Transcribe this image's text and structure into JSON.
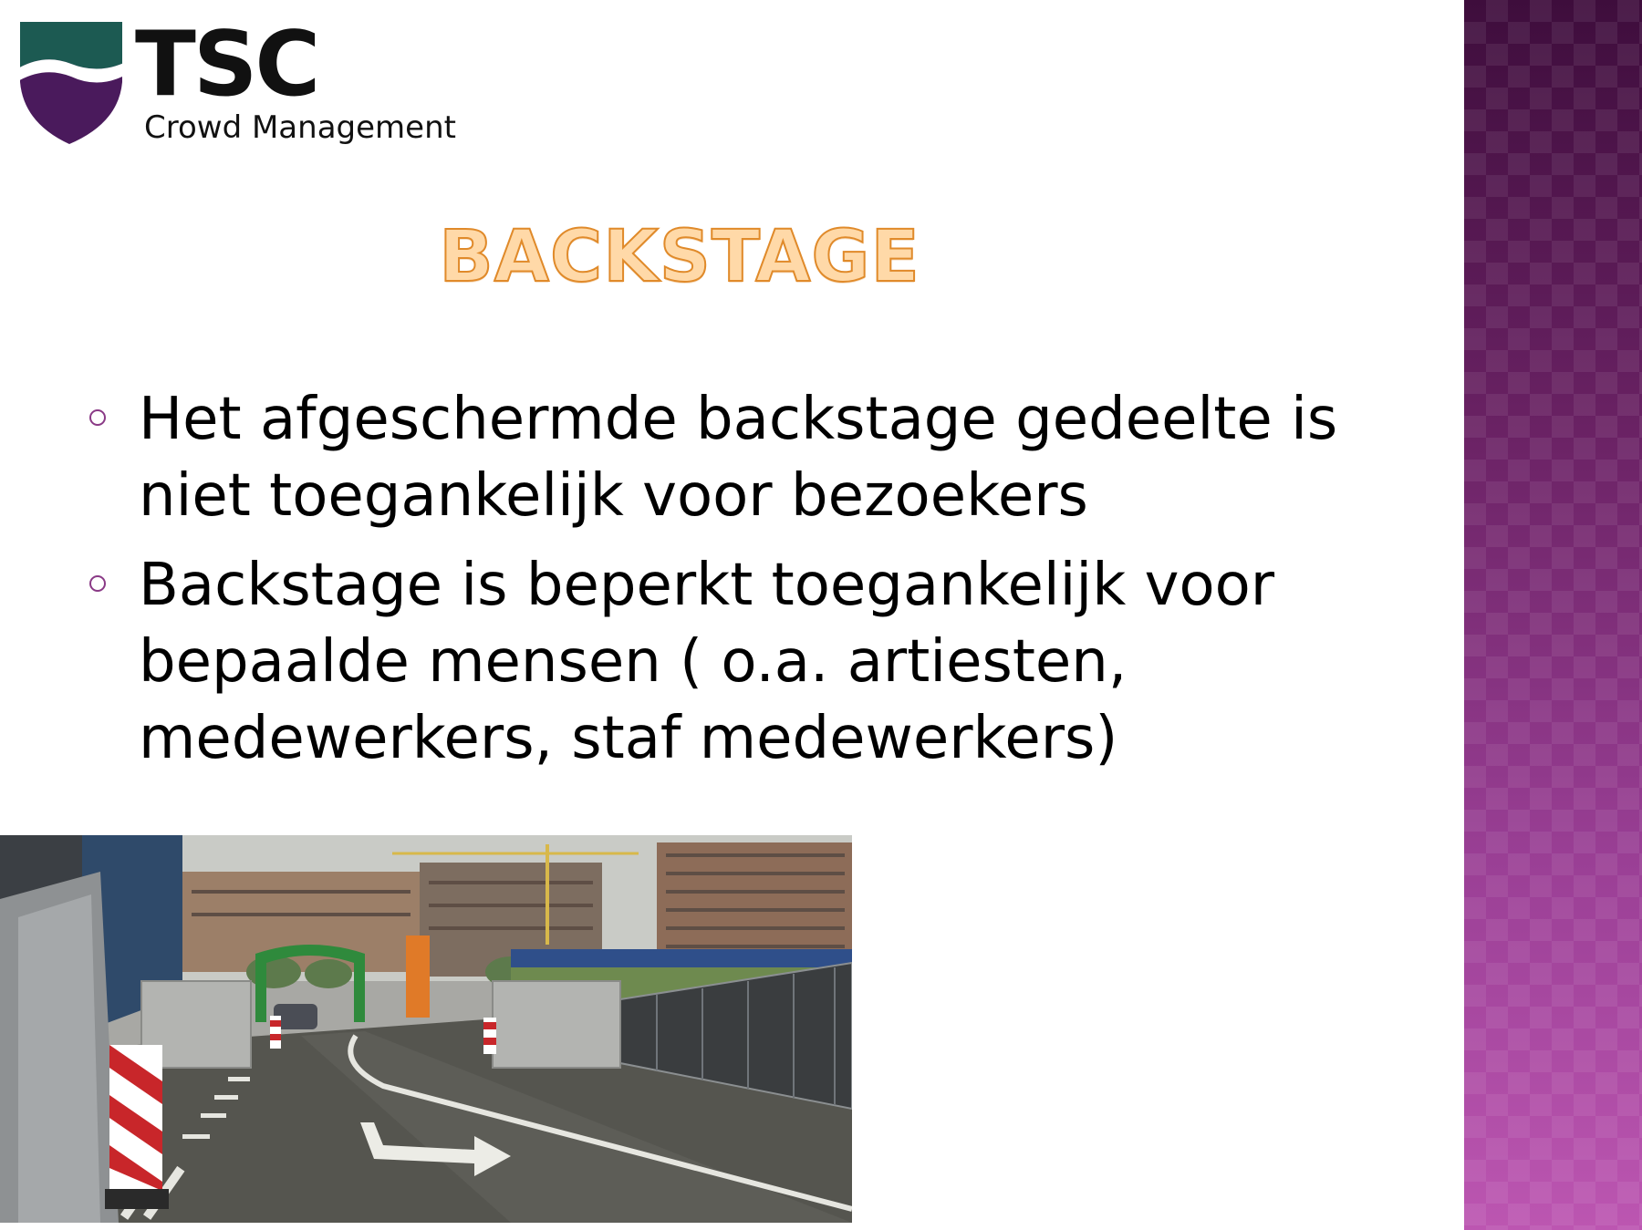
{
  "logo": {
    "name": "TSC",
    "subtitle": "Crowd Management",
    "colors": {
      "teal": "#1c5a52",
      "purple": "#4a1a5c"
    }
  },
  "slide": {
    "title": "BACKSTAGE",
    "title_fill": "#ffd9a8",
    "title_outline": "#e08a2a",
    "accent_color": "#8a3a86"
  },
  "bullets": [
    {
      "text": "Het afgeschermde backstage gedeelte is niet toegankelijk voor bezoekers"
    },
    {
      "text": "Backstage is beperkt toegankelijk voor bepaalde mensen ( o.a. artiesten, medewerkers, staf medewerkers)"
    }
  ],
  "photo": {
    "subject": "backstage access road with fences, barriers and buildings"
  }
}
